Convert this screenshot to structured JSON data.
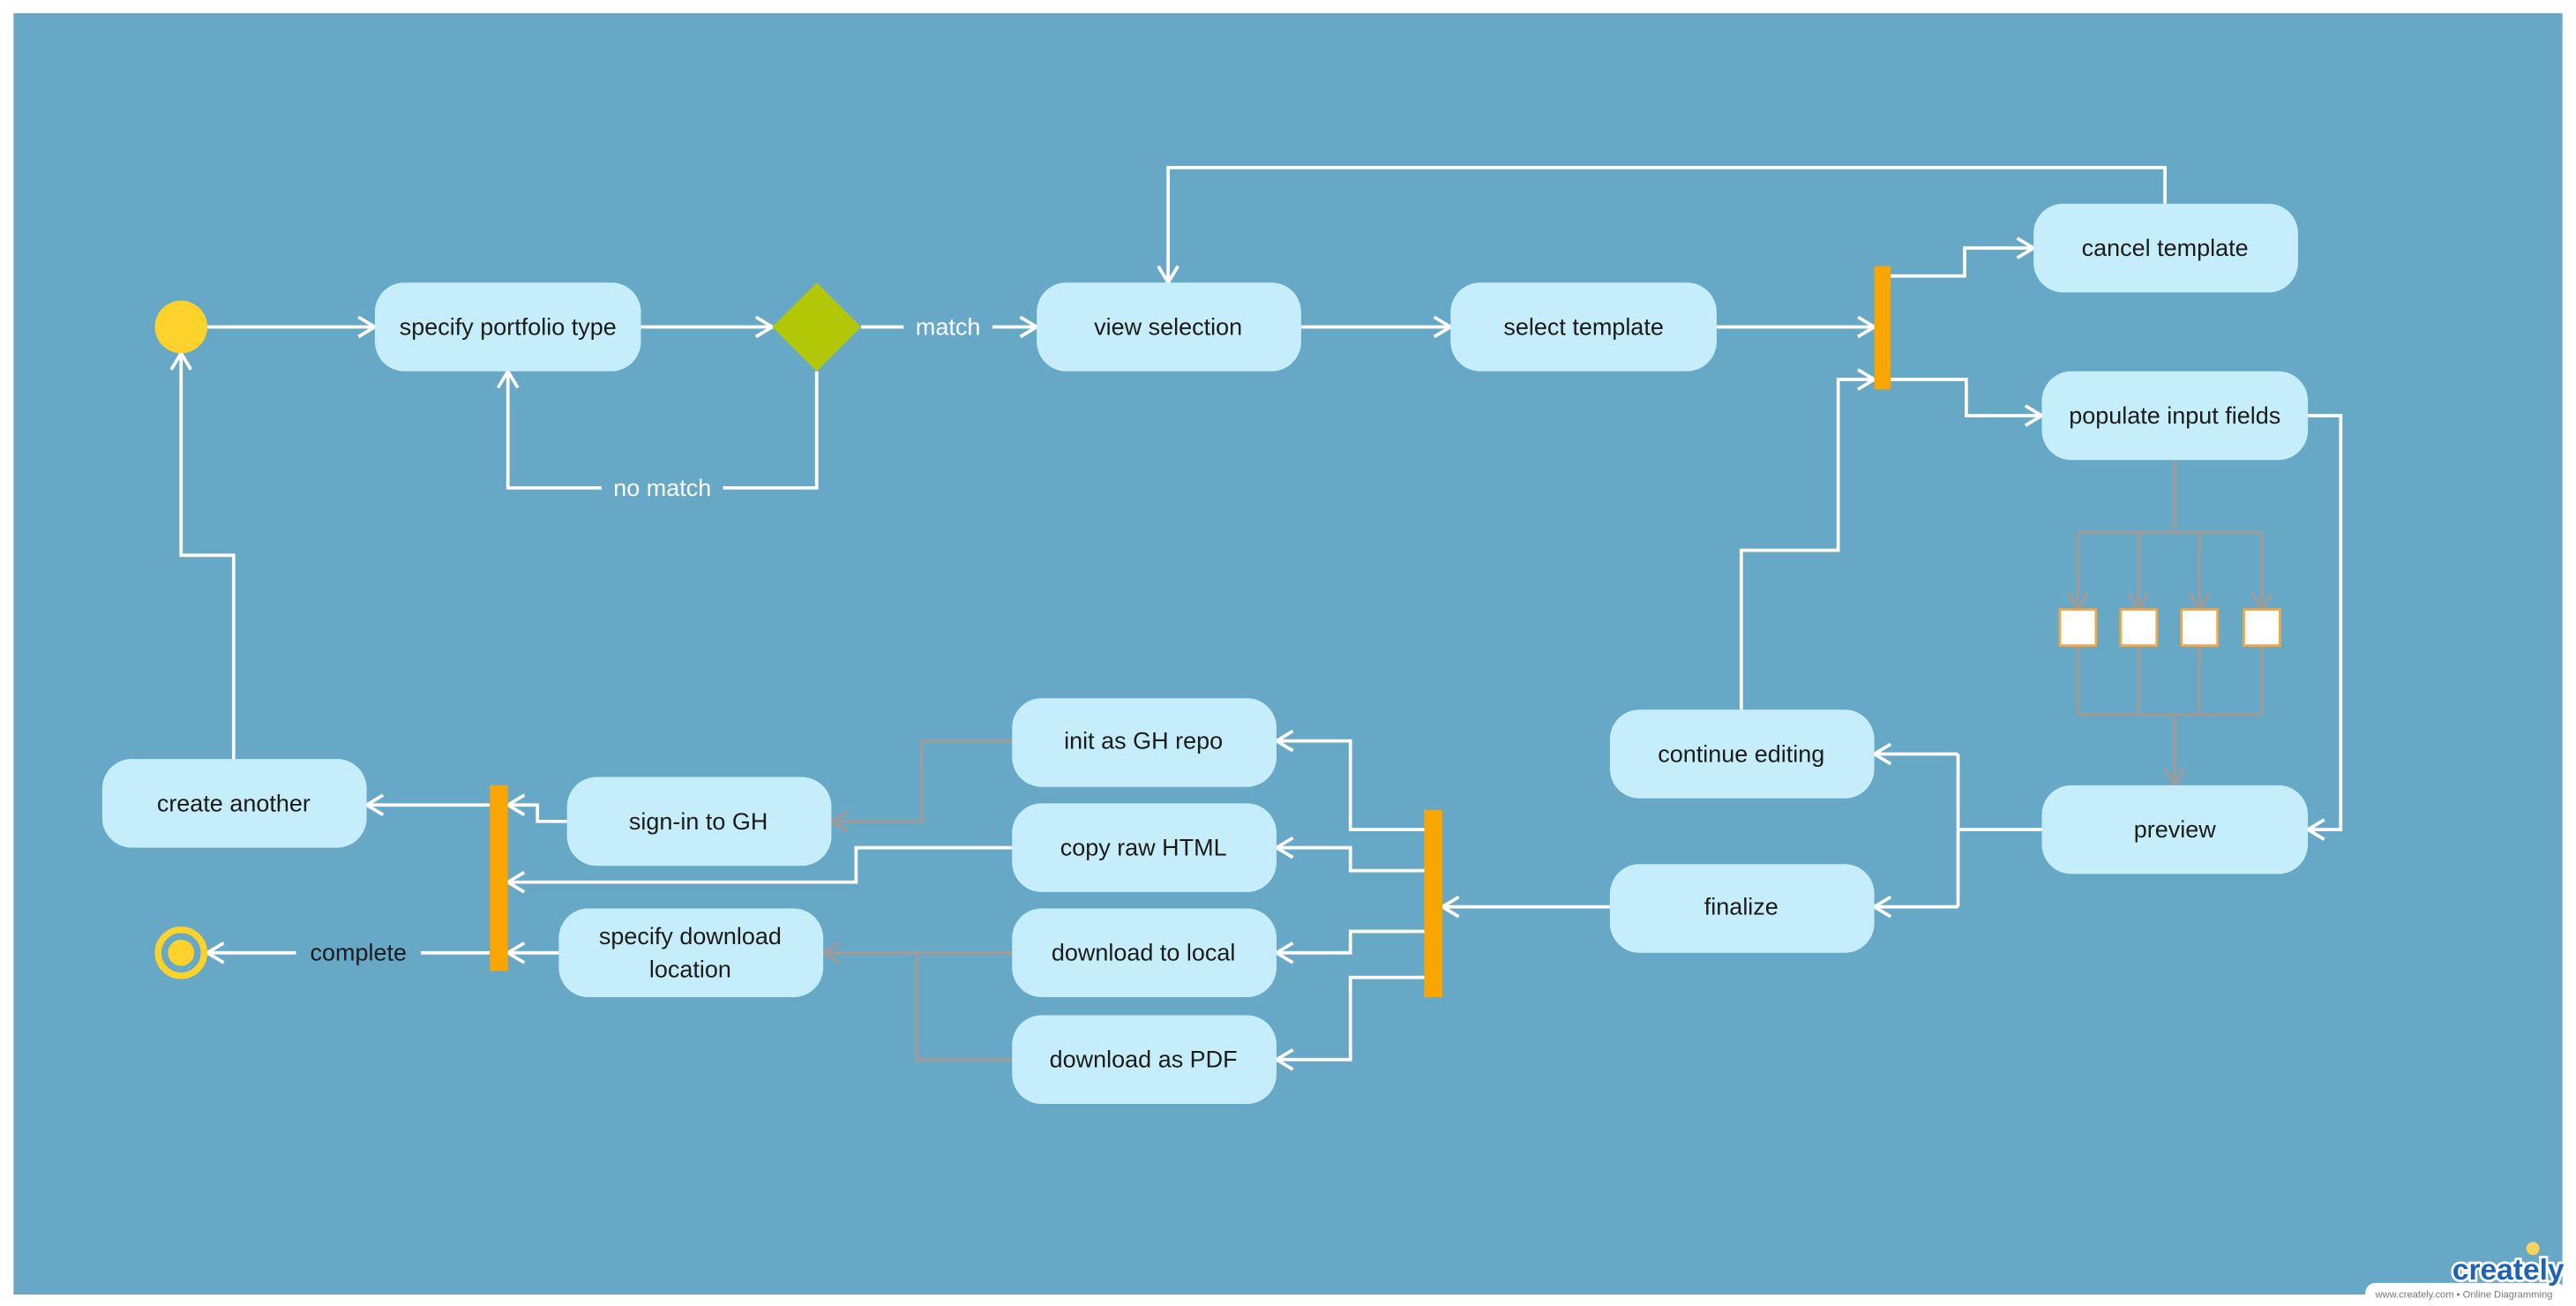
{
  "colors": {
    "background": "#66a8c6",
    "activity": "#c6eefa",
    "start_node": "#fdd22b",
    "decision": "#b2c806",
    "fork_bar": "#f9a602",
    "flow": "#ffffff",
    "secondary_flow": "#9c9c9c"
  },
  "nodes": {
    "specify_portfolio_type": "specify portfolio type",
    "view_selection": "view selection",
    "select_template": "select template",
    "cancel_template": "cancel template",
    "populate_input_fields": "populate input fields",
    "preview": "preview",
    "continue_editing": "continue editing",
    "finalize": "finalize",
    "init_gh_repo": "init as GH repo",
    "copy_raw_html": "copy raw HTML",
    "download_to_local": "download to local",
    "download_as_pdf": "download as PDF",
    "sign_in_gh": "sign-in to GH",
    "specify_download_location_1": "specify download",
    "specify_download_location_2": "location",
    "create_another": "create another"
  },
  "edge_labels": {
    "match": "match",
    "no_match": "no match",
    "complete": "complete"
  },
  "watermark": {
    "brand": "creately",
    "tagline": "www.creately.com • Online Diagramming"
  }
}
